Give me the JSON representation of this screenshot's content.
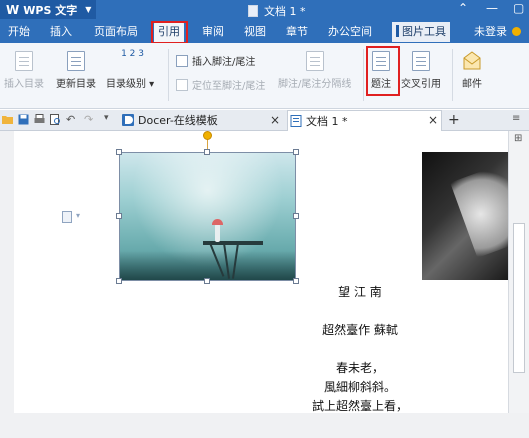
{
  "app": {
    "name": "WPS 文字"
  },
  "window": {
    "title": "文档 1 *"
  },
  "menu_tabs": [
    "开始",
    "插入",
    "页面布局",
    "引用",
    "审阅",
    "视图",
    "章节",
    "办公空间",
    "图片工具"
  ],
  "active_tab": "引用",
  "account": {
    "login_label": "未登录"
  },
  "ribbon": {
    "insert_toc": "插入目录",
    "update_toc": "更新目录",
    "toc_level": "目录级别",
    "insert_footnote": "插入脚注/尾注",
    "goto_footnote": "定位至脚注/尾注",
    "footnote_separator": "脚注/尾注分隔线",
    "caption": "题注",
    "cross_reference": "交叉引用",
    "mail": "邮件",
    "toc_number_glyph": "1 2 3"
  },
  "doc_tabs": [
    {
      "label": "Docer-在线模板",
      "close": "×"
    },
    {
      "label": "文档 1 *",
      "close": "×"
    }
  ],
  "new_tab_glyph": "+",
  "poem": {
    "title": "望 江 南",
    "author": "超然臺作 蘇軾",
    "lines": [
      "春未老，",
      "風細柳斜斜。",
      "試上超然臺上看，"
    ]
  },
  "icons": [
    "save-icon",
    "print-icon",
    "preview-icon",
    "undo-icon",
    "redo-icon",
    "caption-icon",
    "cross-reference-icon",
    "mail-icon"
  ],
  "colors": {
    "title_bar": "#2f6fba",
    "highlight_box": "#e02020",
    "rotate_handle": "#f0b000"
  }
}
